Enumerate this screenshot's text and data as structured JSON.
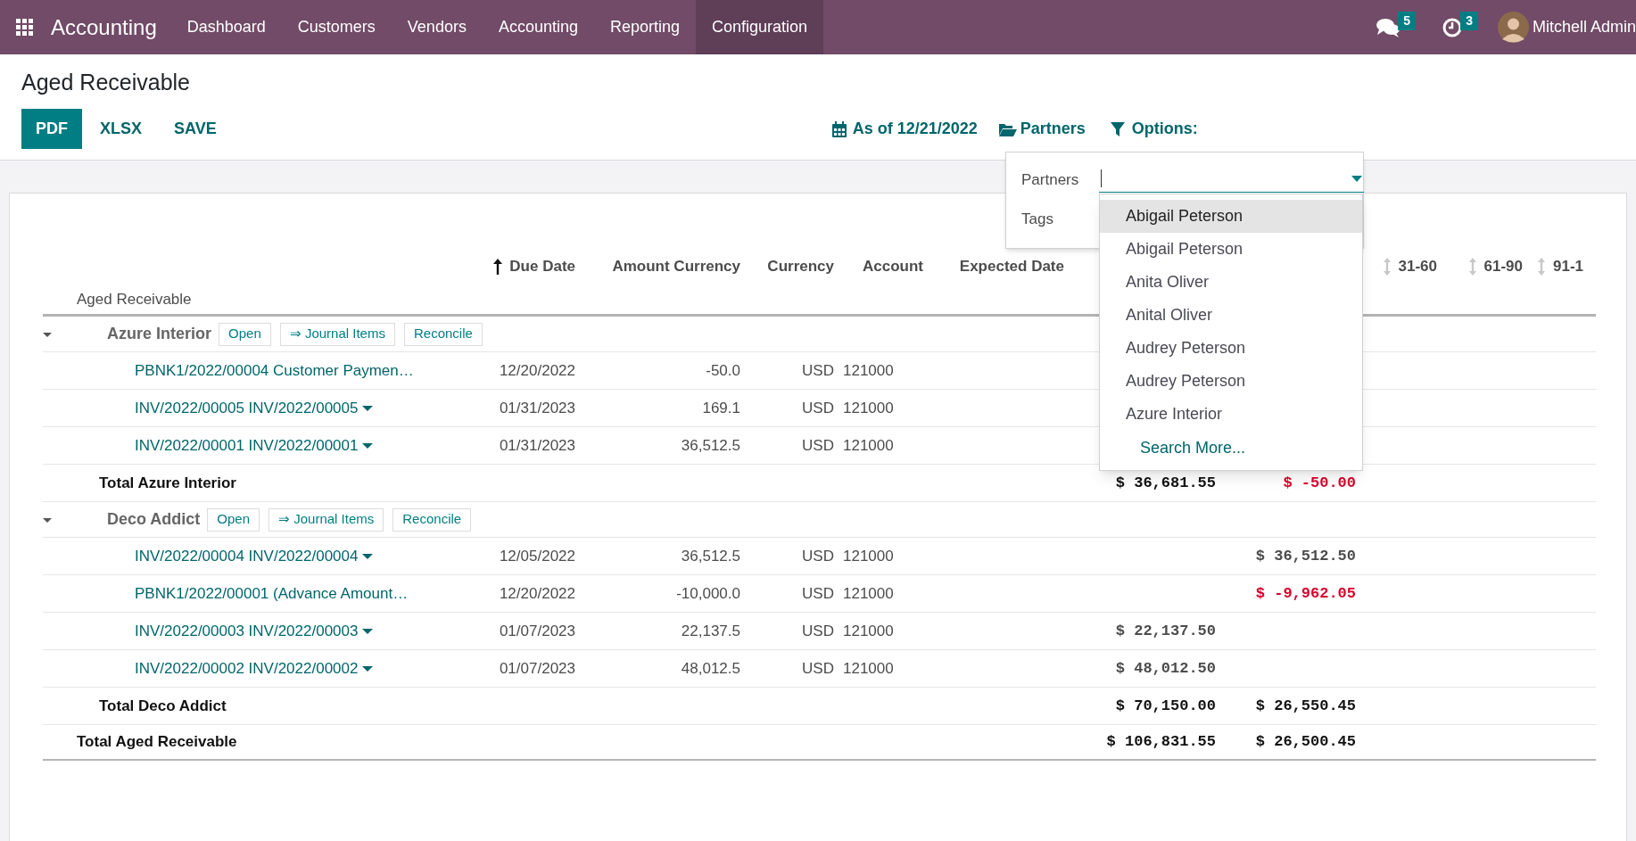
{
  "navbar": {
    "app_name": "Accounting",
    "menu": [
      {
        "label": "Dashboard",
        "selected": false
      },
      {
        "label": "Customers",
        "selected": false
      },
      {
        "label": "Vendors",
        "selected": false
      },
      {
        "label": "Accounting",
        "selected": false
      },
      {
        "label": "Reporting",
        "selected": false
      },
      {
        "label": "Configuration",
        "selected": true
      }
    ],
    "messages_count": "5",
    "activities_count": "3",
    "user": "Mitchell Admin"
  },
  "page": {
    "title": "Aged Receivable",
    "buttons": [
      {
        "label": "PDF",
        "primary": true
      },
      {
        "label": "XLSX",
        "primary": false
      },
      {
        "label": "SAVE",
        "primary": false
      }
    ],
    "filters": [
      {
        "kind": "date",
        "label": "As of 12/21/2022"
      },
      {
        "kind": "partners",
        "label": "Partners"
      },
      {
        "kind": "options",
        "label": "Options:"
      }
    ]
  },
  "partner_filter": {
    "fields": [
      {
        "label": "Partners"
      },
      {
        "label": "Tags"
      }
    ],
    "suggestions": [
      {
        "label": "Abigail Peterson",
        "selected": true
      },
      {
        "label": "Abigail Peterson",
        "selected": false
      },
      {
        "label": "Anita Oliver",
        "selected": false
      },
      {
        "label": "Anital Oliver",
        "selected": false
      },
      {
        "label": "Audrey Peterson",
        "selected": false
      },
      {
        "label": "Audrey Peterson",
        "selected": false
      },
      {
        "label": "Azure Interior",
        "selected": false
      }
    ],
    "search_more": "Search More..."
  },
  "report": {
    "title_row": "Aged Receivable",
    "columns": [
      {
        "label": "Due Date",
        "kind": "sorted"
      },
      {
        "label": "Amount Currency",
        "kind": "plain"
      },
      {
        "label": "Currency",
        "kind": "plain"
      },
      {
        "label": "Account",
        "kind": "plain"
      },
      {
        "label": "Expected Date",
        "kind": "plain"
      },
      {
        "label": "31-60",
        "kind": "sortable"
      },
      {
        "label": "61-90",
        "kind": "sortable"
      },
      {
        "label": "91-1",
        "kind": "sortable"
      }
    ],
    "groups": [
      {
        "name": "Azure Interior",
        "expanded": true,
        "actions": [
          "Open",
          "⇒ Journal Items",
          "Reconcile"
        ],
        "lines": [
          {
            "name": "PBNK1/2022/00004 Customer Paymen…",
            "dropdown": false,
            "due_date": "12/20/2022",
            "amount_currency": "-50.0",
            "currency": "USD",
            "account": "121000"
          },
          {
            "name": "INV/2022/00005 INV/2022/00005",
            "dropdown": true,
            "due_date": "01/31/2023",
            "amount_currency": "169.1",
            "currency": "USD",
            "account": "121000"
          },
          {
            "name": "INV/2022/00001 INV/2022/00001",
            "dropdown": true,
            "due_date": "01/31/2023",
            "amount_currency": "36,512.5",
            "currency": "USD",
            "account": "121000"
          }
        ],
        "total": {
          "label": "Total Azure Interior",
          "column_7": {
            "value": "$ 36,681.55",
            "negative": false
          },
          "column_8": {
            "value": "$ -50.00",
            "negative": true
          }
        }
      },
      {
        "name": "Deco Addict",
        "expanded": true,
        "actions": [
          "Open",
          "⇒ Journal Items",
          "Reconcile"
        ],
        "lines": [
          {
            "name": "INV/2022/00004 INV/2022/00004",
            "dropdown": true,
            "due_date": "12/05/2022",
            "amount_currency": "36,512.5",
            "currency": "USD",
            "account": "121000",
            "column_8": {
              "value": "$ 36,512.50",
              "negative": false
            }
          },
          {
            "name": "PBNK1/2022/00001 (Advance Amount…",
            "dropdown": false,
            "due_date": "12/20/2022",
            "amount_currency": "-10,000.0",
            "currency": "USD",
            "account": "121000",
            "column_8": {
              "value": "$ -9,962.05",
              "negative": true
            }
          },
          {
            "name": "INV/2022/00003 INV/2022/00003",
            "dropdown": true,
            "due_date": "01/07/2023",
            "amount_currency": "22,137.5",
            "currency": "USD",
            "account": "121000",
            "column_7": {
              "value": "$ 22,137.50",
              "negative": false
            }
          },
          {
            "name": "INV/2022/00002 INV/2022/00002",
            "dropdown": true,
            "due_date": "01/07/2023",
            "amount_currency": "48,012.5",
            "currency": "USD",
            "account": "121000",
            "column_7": {
              "value": "$ 48,012.50",
              "negative": false
            }
          }
        ],
        "total": {
          "label": "Total Deco Addict",
          "column_7": {
            "value": "$ 70,150.00",
            "negative": false
          },
          "column_8": {
            "value": "$ 26,550.45",
            "negative": false
          }
        }
      }
    ],
    "grand_total": {
      "label": "Total Aged Receivable",
      "column_7": {
        "value": "$ 106,831.55",
        "negative": false
      },
      "column_8": {
        "value": "$ 26,500.45",
        "negative": false
      }
    }
  }
}
